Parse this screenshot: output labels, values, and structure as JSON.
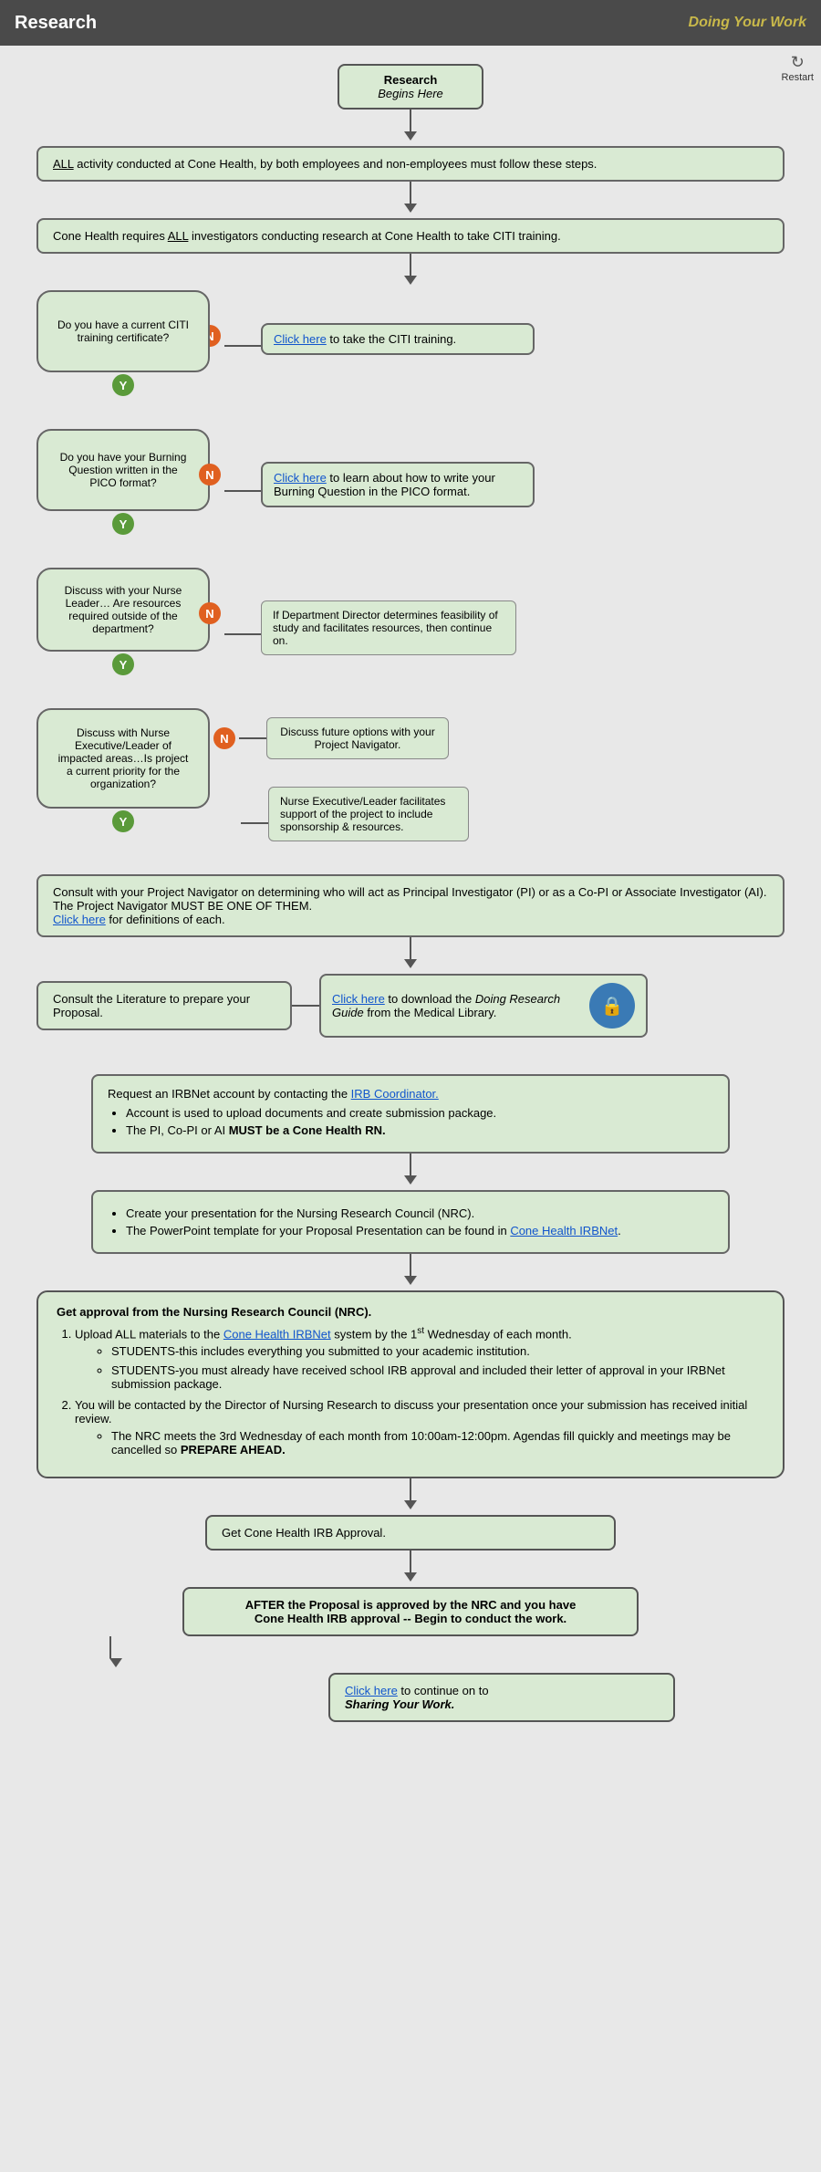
{
  "header": {
    "title": "Research",
    "subtitle": "Doing Your Work"
  },
  "restart": {
    "label": "Restart",
    "icon": "↻"
  },
  "blocks": {
    "start": {
      "line1": "Research",
      "line2": "Begins Here"
    },
    "all_activity": "ALL activity conducted at Cone Health, by both employees and non-employees must follow these steps.",
    "citi_training": "Cone Health requires ALL investigators conducting research at Cone Health to take CITI training.",
    "q1": {
      "question": "Do you have a current CITI training certificate?",
      "n_label": "N",
      "y_label": "Y",
      "n_action": "Click here to take the CITI training.",
      "n_link": "Click here"
    },
    "q2": {
      "question": "Do you have your Burning Question written in the PICO format?",
      "n_label": "N",
      "y_label": "Y",
      "n_action_pre": "",
      "n_link": "Click here",
      "n_action": " to learn about how to write your Burning Question in the PICO format."
    },
    "q3": {
      "question": "Discuss with your Nurse Leader… Are resources required outside of the department?",
      "n_label": "N",
      "y_label": "Y",
      "n_action": "If Department Director determines feasibility of study and facilitates resources, then continue on."
    },
    "q4": {
      "question": "Discuss with Nurse Executive/Leader of impacted areas…Is project a current priority for the organization?",
      "n_label": "N",
      "y_label": "Y",
      "n_action": "Discuss future options with your Project Navigator.",
      "y_action": "Nurse Executive/Leader facilitates support of the project to include sponsorship & resources."
    },
    "consult_pi": {
      "text": "Consult with your Project Navigator on determining who will act as Principal Investigator (PI) or as a Co-PI or Associate Investigator (AI).  The Project Navigator MUST BE ONE OF THEM.",
      "link_text": "Click here",
      "link_suffix": " for definitions of each."
    },
    "consult_lit": {
      "text": "Consult the Literature to prepare your Proposal.",
      "link_text": "Click here",
      "link_suffix": " to download the ",
      "guide": "Doing Research Guide",
      "guide_suffix": " from the Medical Library."
    },
    "irbnet": {
      "intro": "Request an IRBNet account by contacting the ",
      "link": "IRB Coordinator.",
      "bullets": [
        "Account is used to upload documents and create submission package.",
        "The PI, Co-PI or AI MUST be a Cone Health RN."
      ],
      "bold_part": "MUST be a Cone Health RN."
    },
    "presentation": {
      "bullets": [
        "Create your presentation for the Nursing Research Council (NRC).",
        "The PowerPoint template for your Proposal Presentation can be found in Cone Health IRBNet."
      ],
      "link_text": "Cone Health IRBNet"
    },
    "nrc_approval": {
      "intro": "Get approval from the Nursing Research Council (NRC).",
      "items": [
        {
          "num": "1.",
          "text": "Upload ALL materials to the ",
          "link": "Cone Health IRBNet",
          "link_suffix": " system by the 1",
          "sup": "st",
          "suffix": " Wednesday of each month.",
          "bullets": [
            "STUDENTS-this includes everything you submitted to your academic institution.",
            "STUDENTS-you must already have received school IRB approval and included their letter of approval in your IRBNet submission package."
          ]
        },
        {
          "num": "2.",
          "text": "You will be contacted by the Director of Nursing Research to discuss your presentation once your submission has received initial review.",
          "bullets": [
            "The NRC meets the 3rd Wednesday of each month from 10:00am-12:00pm. Agendas fill quickly and meetings may be cancelled so PREPARE AHEAD."
          ]
        }
      ]
    },
    "get_irb": "Get Cone Health IRB Approval.",
    "after_proposal": {
      "line1": "AFTER  the Proposal is approved by the NRC and you have",
      "line2": "Cone Health IRB approval -- Begin to conduct the work."
    },
    "sharing": {
      "pre": "",
      "link": "Click here",
      "suffix": " to continue on to",
      "italic": "Sharing Your Work."
    }
  }
}
